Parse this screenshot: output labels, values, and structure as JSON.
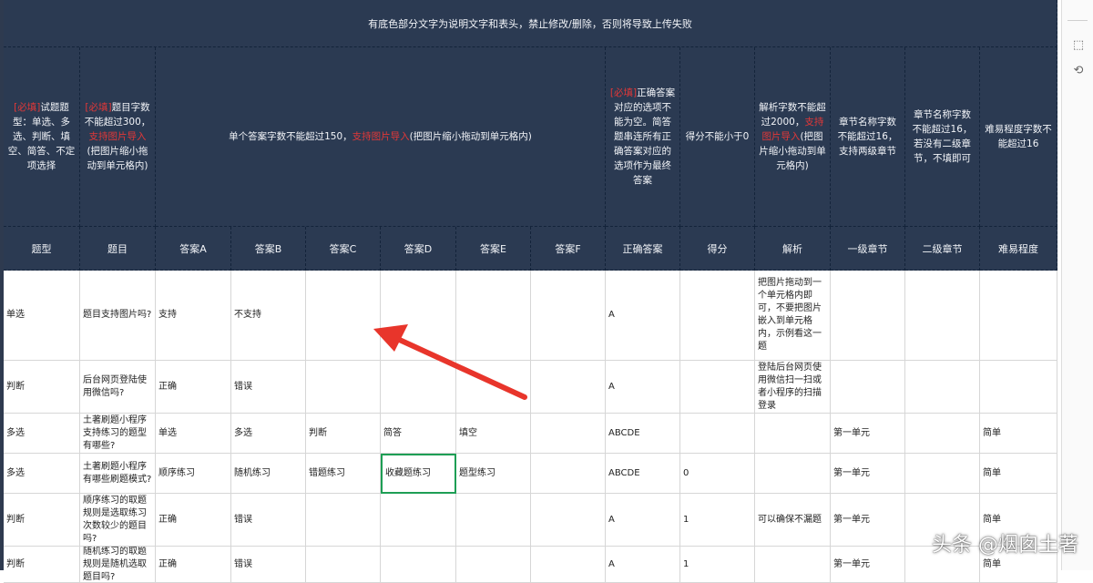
{
  "header_banner": "有底色部分文字为说明文字和表头，禁止修改/删除，否则将导致上传失败",
  "notes": {
    "type": {
      "req": "[必填]",
      "text": "试题题型：单选、多选、判断、填空、简答、不定项选择"
    },
    "question": {
      "req": "[必填]",
      "text1": "题目字数不能超过300，",
      "img": "支持图片导入",
      "text2": "(把图片缩小拖动到单元格内)"
    },
    "answers": {
      "text1": "单个答案字数不能超过150，",
      "img": "支持图片导入",
      "text2": "(把图片缩小拖动到单元格内)"
    },
    "correct": {
      "req": "[必填]",
      "text": "正确答案对应的选项不能为空。简答题串连所有正确答案对应的选项作为最终答案"
    },
    "score": {
      "text": "得分不能小于0"
    },
    "analysis": {
      "text1": "解析字数不能超过2000，",
      "img": "支持图片导入",
      "text2": "(把图片缩小拖动到单元格内)"
    },
    "chapter1": {
      "text": "章节名称字数不能超过16，支持两级章节"
    },
    "chapter2": {
      "text": "章节名称字数不能超过16，若没有二级章节，不填即可"
    },
    "difficulty": {
      "text": "难易程度字数不能超过16"
    }
  },
  "columns": [
    "题型",
    "题目",
    "答案A",
    "答案B",
    "答案C",
    "答案D",
    "答案E",
    "答案F",
    "正确答案",
    "得分",
    "解析",
    "一级章节",
    "二级章节",
    "难易程度"
  ],
  "rows": [
    {
      "type": "单选",
      "question": "题目支持图片吗?",
      "a": "支持",
      "b": "不支持",
      "c": "",
      "d": "",
      "e": "",
      "f": "",
      "correct": "A",
      "score": "",
      "analysis": "把图片拖动到一个单元格内即可，不要把图片嵌入到单元格内，示例看这一题",
      "ch1": "",
      "ch2": "",
      "diff": ""
    },
    {
      "type": "判断",
      "question": "后台网页登陆使用微信吗?",
      "a": "正确",
      "b": "错误",
      "c": "",
      "d": "",
      "e": "",
      "f": "",
      "correct": "A",
      "score": "",
      "analysis": "登陆后台网页使用微信扫一扫或者小程序的扫描登录",
      "ch1": "",
      "ch2": "",
      "diff": ""
    },
    {
      "type": "多选",
      "question": "土著刷题小程序支持练习的题型有哪些?",
      "a": "单选",
      "b": "多选",
      "c": "判断",
      "d": "简答",
      "e": "填空",
      "f": "",
      "correct": "ABCDE",
      "score": "",
      "analysis": "",
      "ch1": "第一单元",
      "ch2": "",
      "diff": "简单"
    },
    {
      "type": "多选",
      "question": "土著刷题小程序有哪些刷题模式?",
      "a": "顺序练习",
      "b": "随机练习",
      "c": "错题练习",
      "d": "收藏题练习",
      "e": "题型练习",
      "f": "",
      "correct": "ABCDE",
      "score": "0",
      "analysis": "",
      "ch1": "第一单元",
      "ch2": "",
      "diff": "简单"
    },
    {
      "type": "判断",
      "question": "顺序练习的取题规则是选取练习次数较少的题目吗?",
      "a": "正确",
      "b": "错误",
      "c": "",
      "d": "",
      "e": "",
      "f": "",
      "correct": "A",
      "score": "1",
      "analysis": "可以确保不漏题",
      "ch1": "第一单元",
      "ch2": "",
      "diff": "简单"
    },
    {
      "type": "判断",
      "question": "随机练习的取题规则是随机选取题目吗?",
      "a": "正确",
      "b": "错误",
      "c": "",
      "d": "",
      "e": "",
      "f": "",
      "correct": "A",
      "score": "1",
      "analysis": "",
      "ch1": "第一单元",
      "ch2": "",
      "diff": "简单"
    }
  ],
  "watermark": "头条 @烟囱土著",
  "colors": {
    "header_bg": "#2b3a52",
    "required_red": "#e23838",
    "selection_green": "#1e9e55",
    "arrow_red": "#e8352b",
    "whale_blue": "#1f78a8"
  },
  "icons": [
    "whale-image-icon",
    "arrow-annotation-icon",
    "panel-tool-icon-1",
    "panel-tool-icon-2"
  ]
}
